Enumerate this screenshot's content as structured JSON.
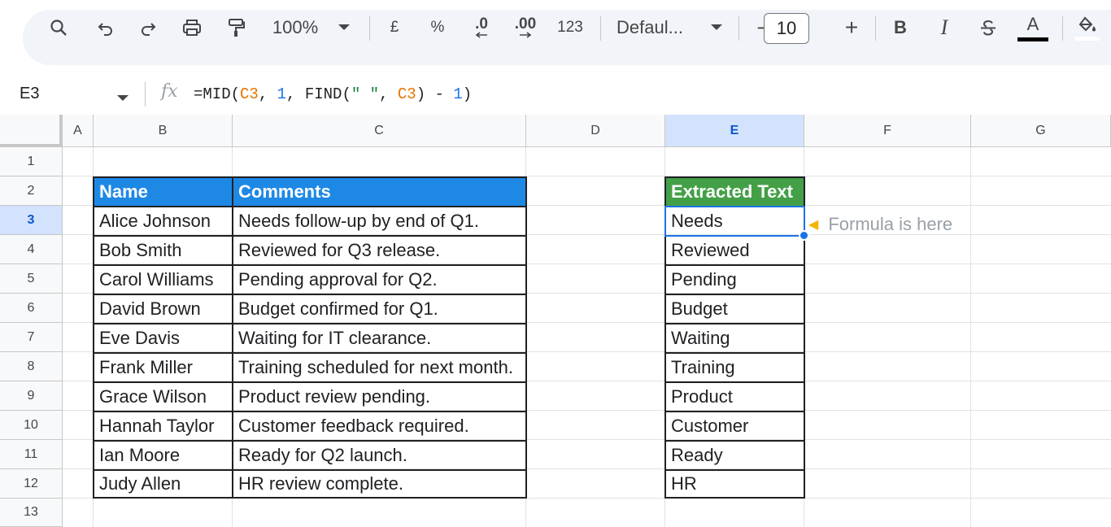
{
  "toolbar": {
    "zoom": "100%",
    "currency": "£",
    "percent": "%",
    "decrease_decimal": ".0",
    "increase_decimal": ".00",
    "number_format": "123",
    "font": "Defaul...",
    "font_size": "10",
    "minus": "−",
    "plus": "+",
    "bold": "B",
    "italic": "I",
    "text_color": "A"
  },
  "formula_bar": {
    "cell_ref": "E3",
    "fx": "fx",
    "formula_parts": [
      "=MID(",
      "C3",
      ", ",
      "1",
      ", FIND(",
      "\" \"",
      ", ",
      "C3",
      ") - ",
      "1",
      ")"
    ]
  },
  "columns": [
    "A",
    "B",
    "C",
    "D",
    "E",
    "F",
    "G"
  ],
  "rows": [
    "1",
    "2",
    "3",
    "4",
    "5",
    "6",
    "7",
    "8",
    "9",
    "10",
    "11",
    "12",
    "13"
  ],
  "table": {
    "headers": {
      "name": "Name",
      "comments": "Comments",
      "extracted": "Extracted Text"
    },
    "names": [
      "Alice Johnson",
      "Bob Smith",
      "Carol Williams",
      "David Brown",
      "Eve Davis",
      "Frank Miller",
      "Grace Wilson",
      "Hannah Taylor",
      "Ian Moore",
      "Judy Allen"
    ],
    "comments": [
      "Needs follow-up by end of Q1.",
      "Reviewed for Q3 release.",
      "Pending approval for Q2.",
      "Budget confirmed for Q1.",
      "Waiting for IT clearance.",
      "Training scheduled for next month.",
      "Product review pending.",
      "Customer feedback required.",
      "Ready for Q2 launch.",
      "HR review complete."
    ],
    "extracted": [
      "Needs",
      "Reviewed",
      "Pending",
      "Budget",
      "Waiting",
      "Training",
      "Product",
      "Customer",
      "Ready",
      "HR"
    ]
  },
  "annotation": {
    "text": "Formula is here",
    "icon": "pointing-hand-icon"
  },
  "colors": {
    "header_blue": "#1e88e5",
    "header_green": "#43a047",
    "selection": "#1a73e8"
  }
}
